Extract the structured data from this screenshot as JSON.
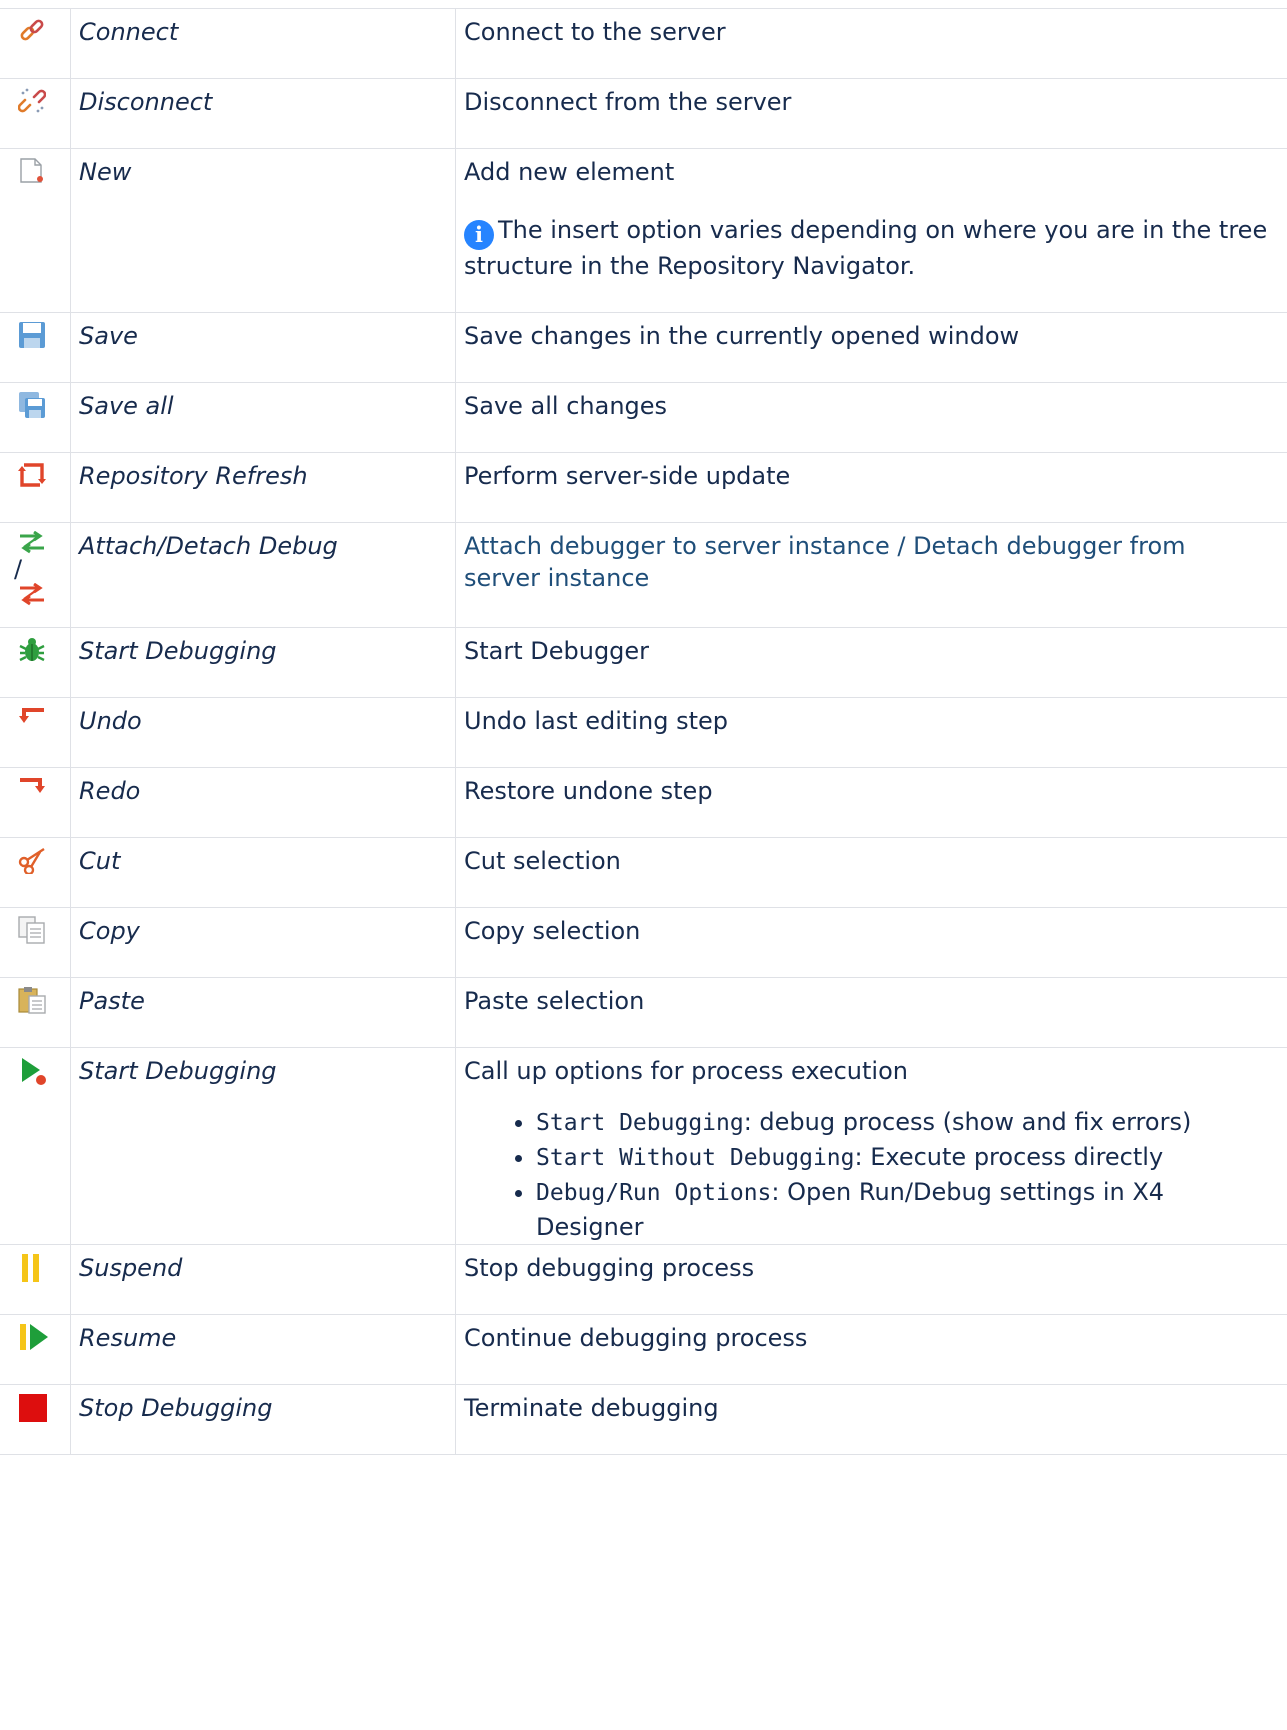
{
  "rows": [
    {
      "name": "Connect",
      "desc": "Connect to the server",
      "icon": "connect-icon"
    },
    {
      "name": "Disconnect",
      "desc": "Disconnect from the server",
      "icon": "disconnect-icon"
    },
    {
      "name": "New",
      "desc": "Add new element",
      "note": "The insert option varies depending on where you are in the tree structure in the Repository Navigator.",
      "icon": "new-document-icon",
      "note_icon": "info-icon"
    },
    {
      "name": "Save",
      "desc": "Save changes in the currently opened window",
      "icon": "save-icon"
    },
    {
      "name": "Save all",
      "desc": "Save all changes",
      "icon": "save-all-icon"
    },
    {
      "name": "Repository Refresh",
      "desc": "Perform server-side update",
      "icon": "refresh-icon"
    },
    {
      "name": "Attach/Detach Debug",
      "desc": "Attach debugger to server instance / Detach debugger from server instance",
      "separator": "/",
      "icon": "attach-debug-icon",
      "icon2": "detach-debug-icon",
      "desc_color": "#1f4e79"
    },
    {
      "name": "Start Debugging",
      "desc": "Start Debugger",
      "icon": "bug-icon"
    },
    {
      "name": "Undo",
      "desc": "Undo last editing step",
      "icon": "undo-icon"
    },
    {
      "name": "Redo",
      "desc": "Restore undone step",
      "icon": "redo-icon"
    },
    {
      "name": "Cut",
      "desc": "Cut selection",
      "icon": "cut-icon"
    },
    {
      "name": "Copy",
      "desc": "Copy selection",
      "icon": "copy-icon"
    },
    {
      "name": "Paste",
      "desc": "Paste selection",
      "icon": "paste-icon"
    },
    {
      "name": "Start Debugging",
      "desc": "Call up options for process execution",
      "icon": "run-icon",
      "options": [
        {
          "code": "Start Debugging",
          "text": ": debug process (show and fix errors)"
        },
        {
          "code": "Start Without Debugging",
          "text": ": Execute process directly"
        },
        {
          "code": "Debug/Run Options",
          "text": ": Open Run/Debug settings in X4 Designer"
        }
      ]
    },
    {
      "name": "Suspend",
      "desc": "Stop debugging process",
      "icon": "suspend-icon"
    },
    {
      "name": "Resume",
      "desc": "Continue debugging process",
      "icon": "resume-icon"
    },
    {
      "name": "Stop Debugging",
      "desc": "Terminate debugging",
      "icon": "stop-icon"
    }
  ],
  "colors": {
    "border": "#dfe1e6",
    "text": "#172b4d",
    "link": "#1f4e79",
    "info": "#2684ff"
  }
}
